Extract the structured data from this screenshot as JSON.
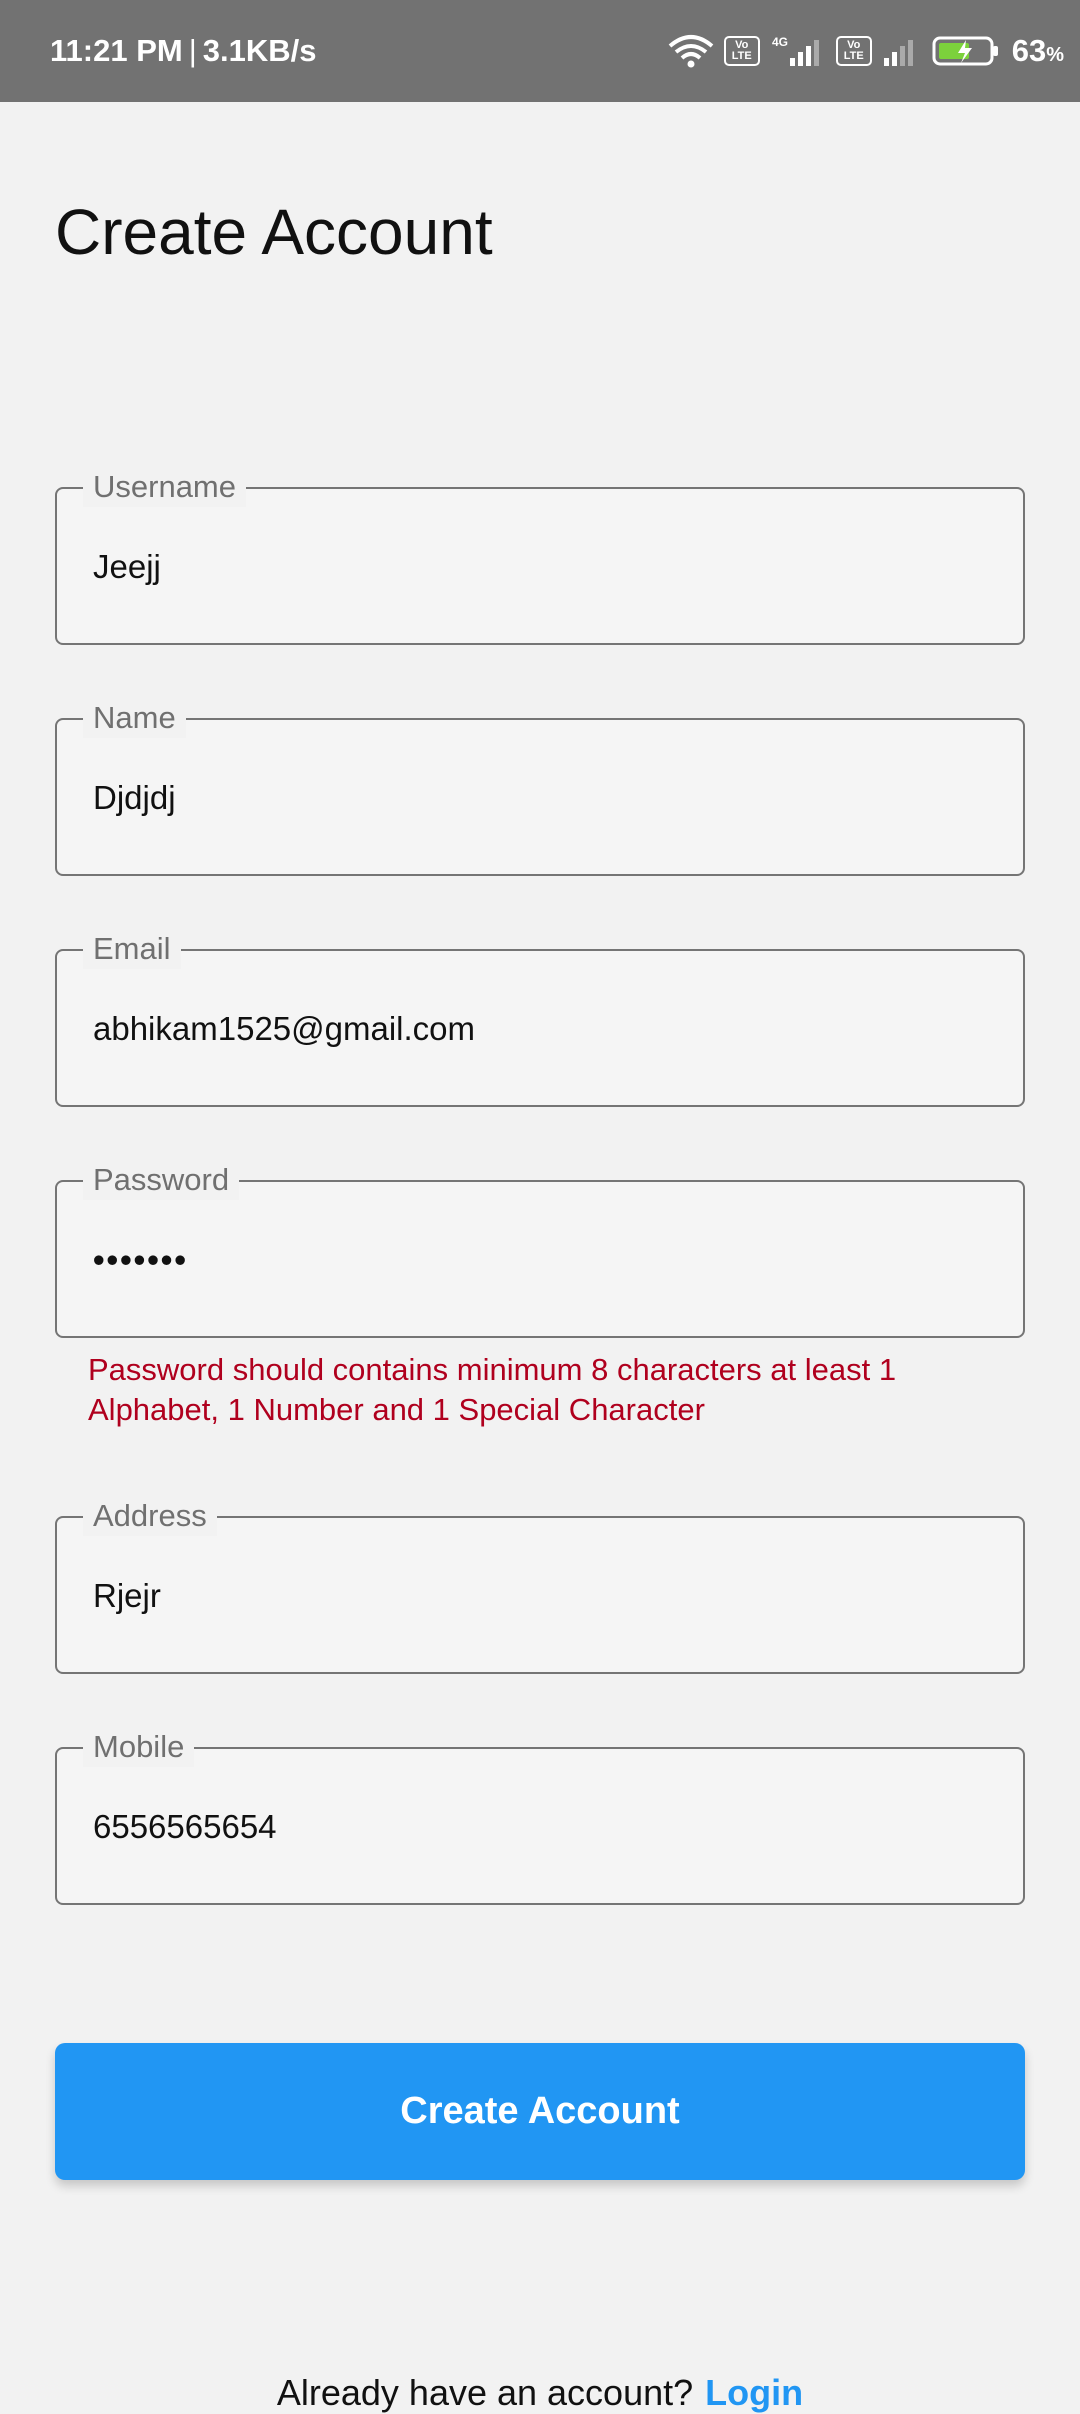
{
  "status_bar": {
    "time": "11:21 PM",
    "separator": "|",
    "speed": "3.1KB/s",
    "battery_percent": "63",
    "battery_unit": "%",
    "volte1": "Vo LTE",
    "volte2": "Vo LTE",
    "network_type": "4G",
    "icons": [
      "wifi-icon",
      "volte-icon",
      "signal-4g-icon",
      "volte-icon",
      "signal-icon",
      "battery-charging-icon"
    ]
  },
  "page": {
    "title": "Create Account"
  },
  "form": {
    "username": {
      "label": "Username",
      "value": "Jeejj"
    },
    "name": {
      "label": "Name",
      "value": "Djdjdj"
    },
    "email": {
      "label": "Email",
      "value": "abhikam1525@gmail.com"
    },
    "password": {
      "label": "Password",
      "value": "•••••••",
      "error": "Password should contains minimum 8 characters at least 1 Alphabet, 1 Number and 1 Special Character"
    },
    "address": {
      "label": "Address",
      "value": "Rjejr"
    },
    "mobile": {
      "label": "Mobile",
      "value": "6556565654"
    }
  },
  "actions": {
    "create_account_label": "Create Account"
  },
  "footer": {
    "prompt": "Already have an account?",
    "login_label": "Login"
  },
  "colors": {
    "accent": "#2196f3",
    "error": "#b0001e",
    "status_bar": "#727272",
    "background": "#f2f2f2"
  }
}
